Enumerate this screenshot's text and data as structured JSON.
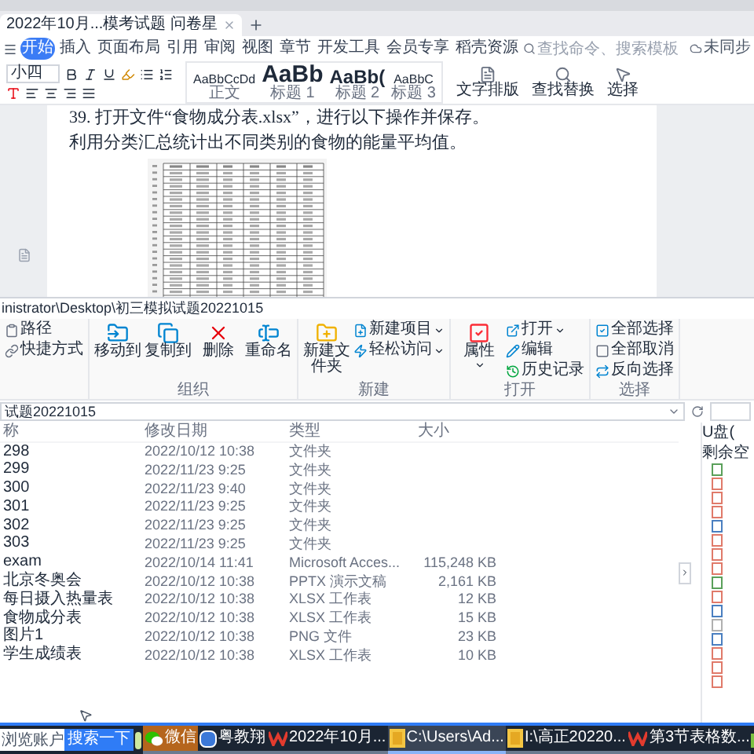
{
  "wps": {
    "doc_tab": {
      "title": "2022年10月...模考试题 问卷星"
    },
    "ribbon_tabs": [
      {
        "label": "开始",
        "selected": true
      },
      {
        "label": "插入",
        "selected": false
      },
      {
        "label": "页面布局",
        "selected": false
      },
      {
        "label": "引用",
        "selected": false
      },
      {
        "label": "审阅",
        "selected": false
      },
      {
        "label": "视图",
        "selected": false
      },
      {
        "label": "章节",
        "selected": false
      },
      {
        "label": "开发工具",
        "selected": false
      },
      {
        "label": "会员专享",
        "selected": false
      },
      {
        "label": "稻壳资源",
        "selected": false
      }
    ],
    "search": {
      "placeholder": "查找命令、搜索模板"
    },
    "sync": "未同步",
    "font_size": "小四",
    "styles": [
      {
        "sample": "AaBbCcDd",
        "label": "正文",
        "kind": "small"
      },
      {
        "sample": "AaBb",
        "label": "标题 1",
        "kind": "big"
      },
      {
        "sample": "AaBb(",
        "label": "标题 2",
        "kind": "medium"
      },
      {
        "sample": "AaBbC",
        "label": "标题 3",
        "kind": "small"
      }
    ],
    "tools": [
      "文字排版",
      "查找替换",
      "选择"
    ],
    "document": {
      "lines": [
        "39. 打开文件“食物成分表.xlsx”，进行以下操作并保存。",
        "利用分类汇总统计出不同类别的食物的能量平均值。"
      ]
    }
  },
  "explorer": {
    "path": "inistrator\\Desktop\\初三模拟试题20221015",
    "ribbon_groups": [
      {
        "buttons": [
          {
            "label": "路径",
            "kind": "small"
          },
          {
            "label": "快捷方式",
            "kind": "small"
          }
        ]
      },
      {
        "label": "组织",
        "buttons": [
          {
            "label": "移动到",
            "kind": "large"
          },
          {
            "label": "复制到",
            "kind": "large"
          },
          {
            "label": "删除",
            "kind": "large"
          },
          {
            "label": "重命名",
            "kind": "large"
          }
        ]
      },
      {
        "label": "新建",
        "buttons": [
          {
            "label": "新建文件夹",
            "kind": "large"
          },
          {
            "label": "新建项目",
            "kind": "small",
            "menu": true
          },
          {
            "label": "轻松访问",
            "kind": "small",
            "menu": true
          }
        ]
      },
      {
        "label": "打开",
        "buttons": [
          {
            "label": "属性",
            "kind": "large",
            "menu": true
          },
          {
            "label": "打开",
            "kind": "small",
            "menu": true
          },
          {
            "label": "编辑",
            "kind": "small"
          },
          {
            "label": "历史记录",
            "kind": "small"
          }
        ]
      },
      {
        "label": "选择",
        "buttons": [
          {
            "label": "全部选择",
            "kind": "small"
          },
          {
            "label": "全部取消",
            "kind": "small"
          },
          {
            "label": "反向选择",
            "kind": "small"
          }
        ]
      }
    ],
    "address": "试题20221015",
    "columns": [
      "称",
      "修改日期",
      "类型",
      "大小"
    ],
    "rows": [
      {
        "name": "298",
        "date": "2022/10/12 10:38",
        "type": "文件夹"
      },
      {
        "name": "299",
        "date": "2022/11/23 9:25",
        "type": "文件夹"
      },
      {
        "name": "300",
        "date": "2022/11/23 9:40",
        "type": "文件夹"
      },
      {
        "name": "301",
        "date": "2022/11/23 9:25",
        "type": "文件夹"
      },
      {
        "name": "302",
        "date": "2022/11/23 9:25",
        "type": "文件夹"
      },
      {
        "name": "303",
        "date": "2022/11/23 9:25",
        "type": "文件夹"
      },
      {
        "name": "exam",
        "date": "2022/10/14 11:41",
        "type": "Microsoft Acces...",
        "size": "115,248 KB"
      },
      {
        "name": "北京冬奥会",
        "date": "2022/10/12 10:38",
        "type": "PPTX 演示文稿",
        "size": "2,161 KB"
      },
      {
        "name": "每日摄入热量表",
        "date": "2022/10/12 10:38",
        "type": "XLSX 工作表",
        "size": "12 KB"
      },
      {
        "name": "食物成分表",
        "date": "2022/10/12 10:38",
        "type": "XLSX 工作表",
        "size": "15 KB"
      },
      {
        "name": "图片1",
        "date": "2022/10/12 10:38",
        "type": "PNG 文件",
        "size": "23 KB"
      },
      {
        "name": "学生成绩表",
        "date": "2022/10/12 10:38",
        "type": "XLSX 工作表",
        "size": "10 KB"
      }
    ],
    "side_panel": {
      "title": "U盘(",
      "subtitle": "剩余空",
      "files": [
        {
          "color": "#5aa05a"
        },
        {
          "color": "#e07a6a"
        },
        {
          "color": "#e07a6a"
        },
        {
          "color": "#e07a6a"
        },
        {
          "color": "#4a7fc0"
        },
        {
          "color": "#e07a6a"
        },
        {
          "color": "#e07a6a"
        },
        {
          "color": "#e07a6a"
        },
        {
          "color": "#5aa05a"
        },
        {
          "color": "#e07a6a"
        },
        {
          "color": "#4a7fc0"
        },
        {
          "color": "#b0b0b0"
        },
        {
          "color": "#4a7fc0"
        },
        {
          "color": "#e07a6a"
        },
        {
          "color": "#e07a6a"
        },
        {
          "color": "#e07a6a"
        }
      ]
    }
  },
  "taskbar": {
    "search": {
      "placeholder": "浏览账户"
    },
    "search_button": "搜索一下",
    "items": [
      {
        "label": "微信",
        "kind": "wechat",
        "selected": false,
        "flashing": true
      },
      {
        "label": "粤教翔",
        "kind": "app",
        "selected": false,
        "flashing": false
      },
      {
        "label": "2022年10月...",
        "kind": "wps",
        "selected": false,
        "flashing": false
      },
      {
        "label": "C:\\Users\\Ad...",
        "kind": "folder",
        "selected": true,
        "flashing": false
      },
      {
        "label": "I:\\高正20220...",
        "kind": "folder",
        "selected": false,
        "flashing": false
      },
      {
        "label": "第3节表格数...",
        "kind": "wps",
        "selected": false,
        "flashing": false
      }
    ]
  }
}
